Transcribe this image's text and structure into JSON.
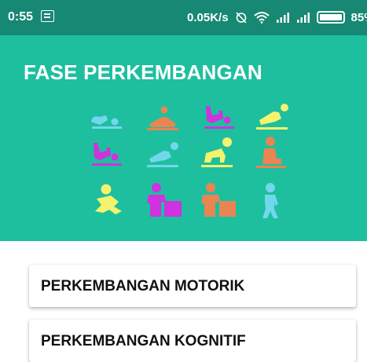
{
  "status_bar": {
    "time": "0:55",
    "network_speed": "0.05K/s",
    "battery_text": "85%",
    "icons": [
      "notification-icon",
      "alarm-off-icon",
      "wifi-icon",
      "signal-icon",
      "signal-icon",
      "battery-icon"
    ]
  },
  "header": {
    "title": "FASE PERKEMBANGAN",
    "background_color": "#1ebf9e",
    "status_bar_color": "#168873",
    "stage_icons": [
      {
        "name": "baby-lying-icon",
        "color": "#72d7ec"
      },
      {
        "name": "baby-lying-icon",
        "color": "#e88552"
      },
      {
        "name": "baby-kicking-icon",
        "color": "#cf32df"
      },
      {
        "name": "baby-tummy-icon",
        "color": "#f4f36e"
      },
      {
        "name": "baby-kicking-icon",
        "color": "#cf32df"
      },
      {
        "name": "baby-tummy-icon",
        "color": "#72d7ec"
      },
      {
        "name": "baby-crawling-icon",
        "color": "#f4f36e"
      },
      {
        "name": "baby-sitting-icon",
        "color": "#e88552"
      },
      {
        "name": "baby-crawling-icon",
        "color": "#f4f36e"
      },
      {
        "name": "child-standing-box-icon",
        "color": "#cf32df"
      },
      {
        "name": "child-standing-box-icon",
        "color": "#e88552"
      },
      {
        "name": "child-walking-icon",
        "color": "#72d7ec"
      }
    ]
  },
  "menu": {
    "items": [
      {
        "label": "PERKEMBANGAN MOTORIK"
      },
      {
        "label": "PERKEMBANGAN KOGNITIF"
      }
    ]
  }
}
